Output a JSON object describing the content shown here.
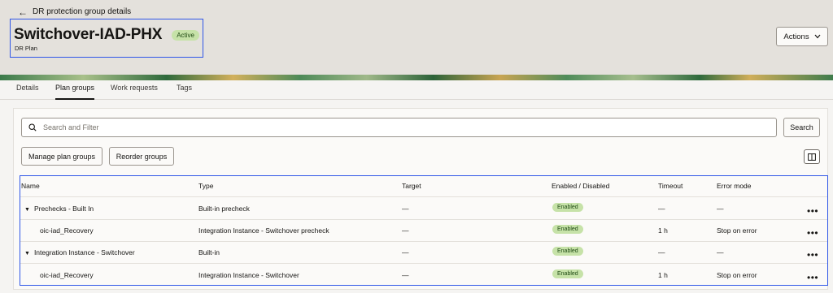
{
  "header": {
    "back_label": "DR protection group details",
    "title": "Switchover-IAD-PHX",
    "status": "Active",
    "subtitle": "DR Plan",
    "actions_label": "Actions"
  },
  "tabs": [
    {
      "label": "Details"
    },
    {
      "label": "Plan groups"
    },
    {
      "label": "Work requests"
    },
    {
      "label": "Tags"
    }
  ],
  "active_tab": "Plan groups",
  "toolbar": {
    "search_placeholder": "Search and Filter",
    "search_label": "Search",
    "manage_label": "Manage plan groups",
    "reorder_label": "Reorder groups"
  },
  "table": {
    "columns": [
      "Name",
      "Type",
      "Target",
      "Enabled / Disabled",
      "Timeout",
      "Error mode"
    ],
    "rows": [
      {
        "name": "Prechecks - Built In",
        "type": "Built-in precheck",
        "target": "—",
        "enabled": "Enabled",
        "timeout": "—",
        "error_mode": "—"
      },
      {
        "name": "oic-iad_Recovery",
        "type": "Integration Instance - Switchover precheck",
        "target": "—",
        "enabled": "Enabled",
        "timeout": "1 h",
        "error_mode": "Stop on error"
      },
      {
        "name": "Integration Instance - Switchover",
        "type": "Built-in",
        "target": "—",
        "enabled": "Enabled",
        "timeout": "—",
        "error_mode": "—"
      },
      {
        "name": "oic-iad_Recovery",
        "type": "Integration Instance - Switchover",
        "target": "—",
        "enabled": "Enabled",
        "timeout": "1 h",
        "error_mode": "Stop on error"
      }
    ]
  },
  "colors": {
    "accent": "#2f56e8",
    "badge_bg": "#c6e2a8",
    "header_bg": "#e4e1dc"
  }
}
